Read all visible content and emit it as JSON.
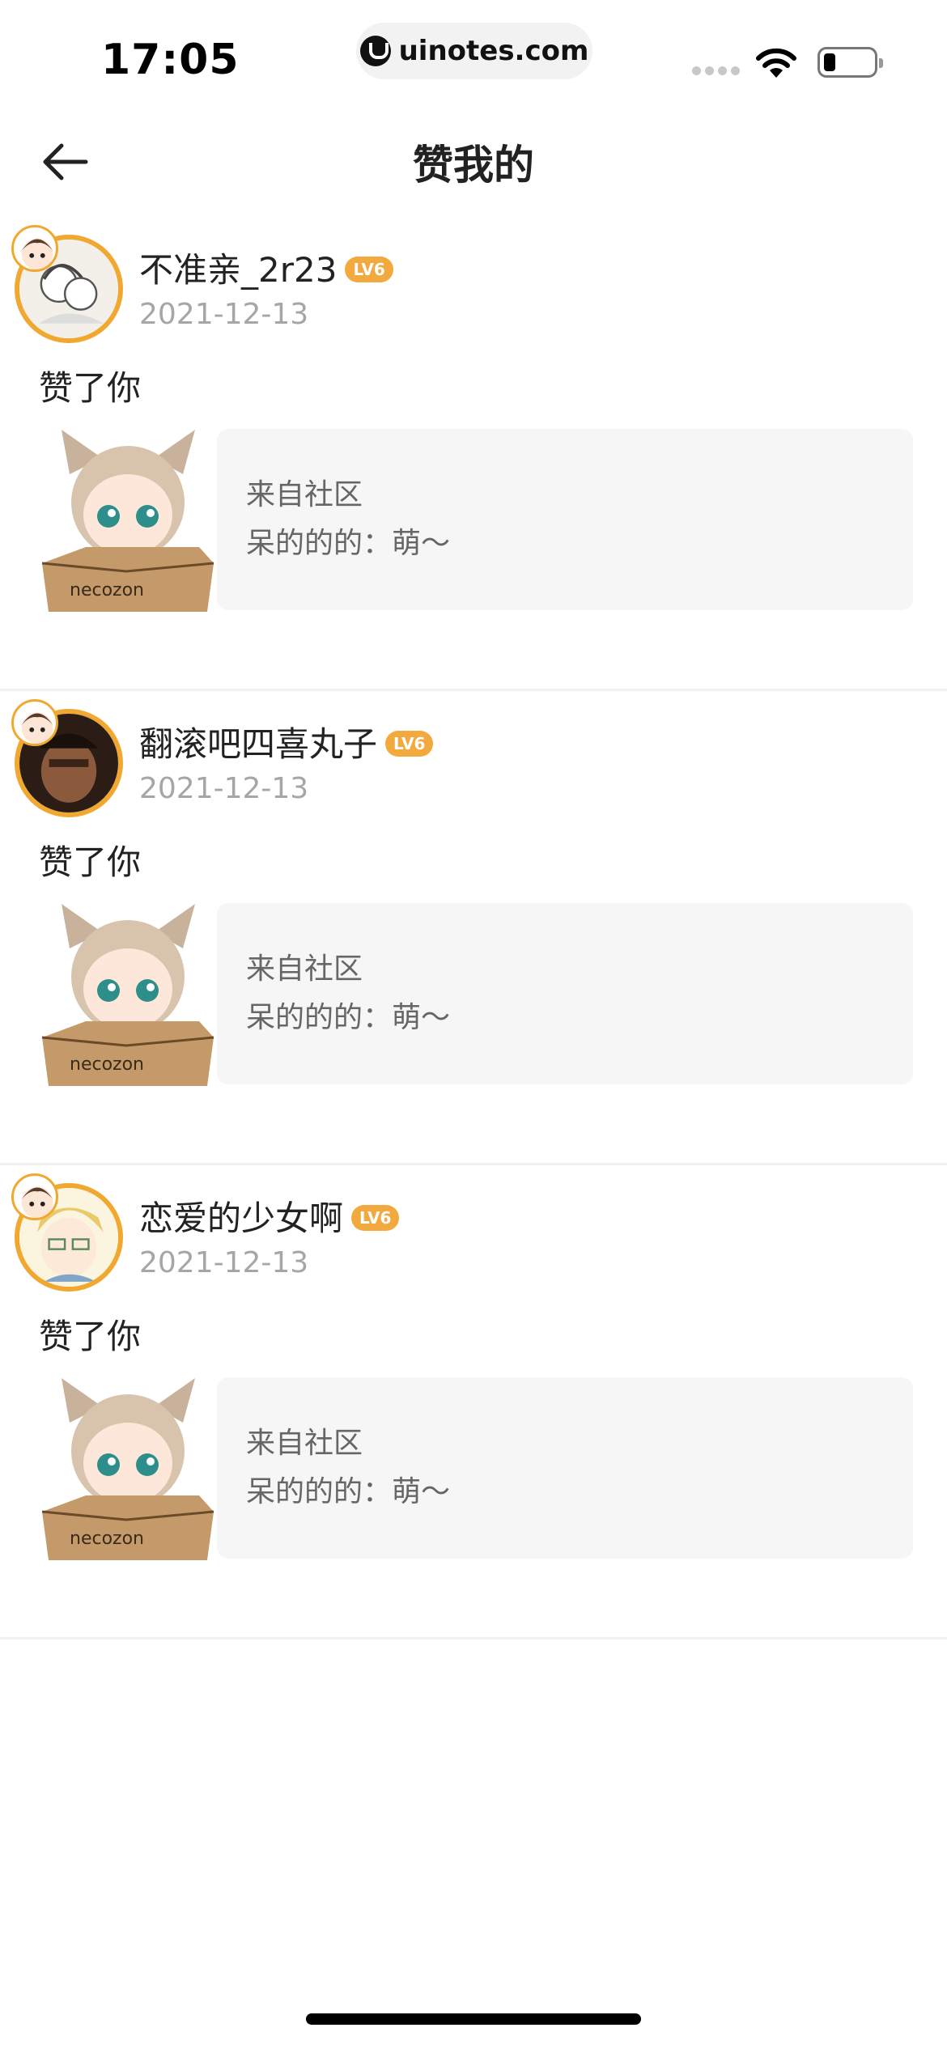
{
  "status_bar": {
    "time": "17:05",
    "url": "uinotes.com"
  },
  "header": {
    "title": "赞我的",
    "back_icon": "arrow-left-icon"
  },
  "notifications": [
    {
      "username": "不准亲_2r23",
      "level": "LV6",
      "date": "2021-12-13",
      "action": "赞了你",
      "source": "来自社区",
      "content": "呆的的的：萌～"
    },
    {
      "username": "翻滚吧四喜丸子",
      "level": "LV6",
      "date": "2021-12-13",
      "action": "赞了你",
      "source": "来自社区",
      "content": "呆的的的：萌～"
    },
    {
      "username": "恋爱的少女啊",
      "level": "LV6",
      "date": "2021-12-13",
      "action": "赞了你",
      "source": "来自社区",
      "content": "呆的的的：萌～"
    }
  ],
  "colors": {
    "accent": "#f2a93e",
    "muted_text": "#a6a6a6",
    "ref_bg": "#f6f6f6"
  }
}
